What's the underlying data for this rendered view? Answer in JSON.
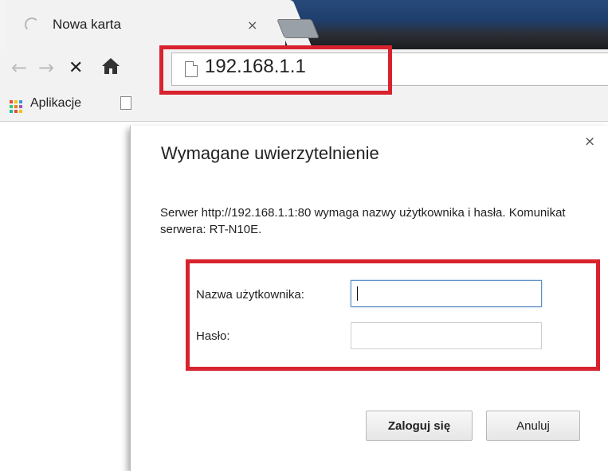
{
  "browser": {
    "tab": {
      "title": "Nowa karta",
      "close": "×"
    },
    "address": {
      "url": "192.168.1.1"
    },
    "bookmarks": {
      "apps_label": "Aplikacje"
    }
  },
  "dialog": {
    "title": "Wymagane uwierzytelnienie",
    "close": "×",
    "message": "Serwer http://192.168.1.1:80 wymaga nazwy użytkownika i hasła. Komunikat serwera: RT-N10E.",
    "username_label": "Nazwa użytkownika:",
    "username_value": "",
    "password_label": "Hasło:",
    "password_value": "",
    "login_button": "Zaloguj się",
    "cancel_button": "Anuluj"
  },
  "colors": {
    "highlight": "#d8232e",
    "focus_border": "#5e8fc8"
  }
}
